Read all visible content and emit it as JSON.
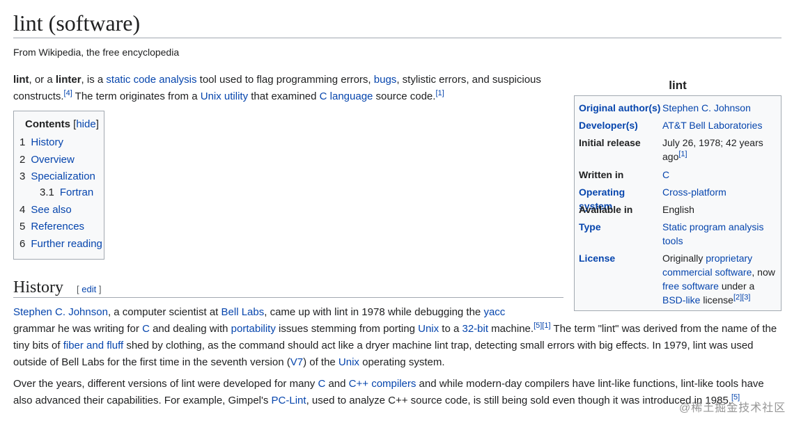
{
  "page": {
    "title": "lint (software)",
    "tagline": "From Wikipedia, the free encyclopedia"
  },
  "lead": {
    "b1": "lint",
    "t1": ", or a ",
    "b2": "linter",
    "t2": ", is a ",
    "l1": "static code analysis",
    "t3": " tool used to flag programming errors, ",
    "l2": "bugs",
    "t4": ", stylistic errors, and suspicious constructs.",
    "r1": "[4]",
    "t5": " The term originates from a ",
    "l3": "Unix utility",
    "t6": " that examined ",
    "l4": "C language",
    "t7": " source code.",
    "r2": "[1]"
  },
  "toc": {
    "title": "Contents",
    "hide_open": " [",
    "hide": "hide",
    "hide_close": "]",
    "items": [
      {
        "num": "1",
        "label": "History"
      },
      {
        "num": "2",
        "label": "Overview"
      },
      {
        "num": "3",
        "label": "Specialization"
      },
      {
        "num": "3.1",
        "label": "Fortran"
      },
      {
        "num": "4",
        "label": "See also"
      },
      {
        "num": "5",
        "label": "References"
      },
      {
        "num": "6",
        "label": "Further reading"
      }
    ]
  },
  "history": {
    "title": "History",
    "edit_open": "[ ",
    "edit": "edit",
    "edit_close": " ]",
    "p1": {
      "l1": "Stephen C. Johnson",
      "t1": ", a computer scientist at ",
      "l2": "Bell Labs",
      "t2": ", came up with lint in 1978 while debugging the ",
      "l3": "yacc",
      "t3": " grammar he was writing for ",
      "l4": "C",
      "t4": " and dealing with ",
      "l5": "portability",
      "t5": " issues stemming from porting ",
      "l6": "Unix",
      "t6": " to a ",
      "l7": "32-bit",
      "t7": " machine.",
      "r1": "[5]",
      "r2": "[1]",
      "t8": " The term \"lint\" was derived from the name of the tiny bits of ",
      "l8": "fiber and fluff",
      "t9": " shed by clothing, as the command should act like a dryer machine lint trap, detecting small errors with big effects. In 1979, lint was used outside of Bell Labs for the first time in the seventh version (",
      "l9": "V7",
      "t10": ") of the ",
      "l10": "Unix",
      "t11": " operating system."
    },
    "p2": {
      "t1": "Over the years, different versions of lint were developed for many ",
      "l1": "C",
      "t2": " and ",
      "l2": "C++ compilers",
      "t3": " and while modern-day compilers have lint-like functions, lint-like tools have also advanced their capabilities. For example, Gimpel's ",
      "l3": "PC-Lint",
      "t4": ", used to analyze C++ source code, is still being sold even though it was introduced in 1985.",
      "r1": "[5]"
    }
  },
  "infobox": {
    "title": "lint",
    "rows": [
      {
        "label": "Original author(s)",
        "value": "Stephen C. Johnson"
      },
      {
        "label": "Developer(s)",
        "value": "AT&T Bell Laboratories"
      },
      {
        "label": "Initial release",
        "value": "July 26, 1978; 42 years ago",
        "ref": "[1]"
      },
      {
        "label": "Written in",
        "value": "C"
      },
      {
        "label": "Operating system",
        "value": "Cross-platform"
      },
      {
        "label": "Available in",
        "value": "English"
      },
      {
        "label": "Type",
        "value": "Static program analysis tools"
      },
      {
        "label": "License",
        "v1": "Originally ",
        "l1": "proprietary commercial software",
        "v2": ", now ",
        "l2": "free software",
        "v3": " under a ",
        "l3": "BSD-like",
        "v4": " license",
        "refs": "[2][3]"
      }
    ]
  },
  "watermark": "@稀土掘金技术社区",
  "colors": {
    "link": "#0645ad",
    "text": "#202122",
    "box_bg": "#f8f9fa",
    "border": "#a2a9b1"
  }
}
